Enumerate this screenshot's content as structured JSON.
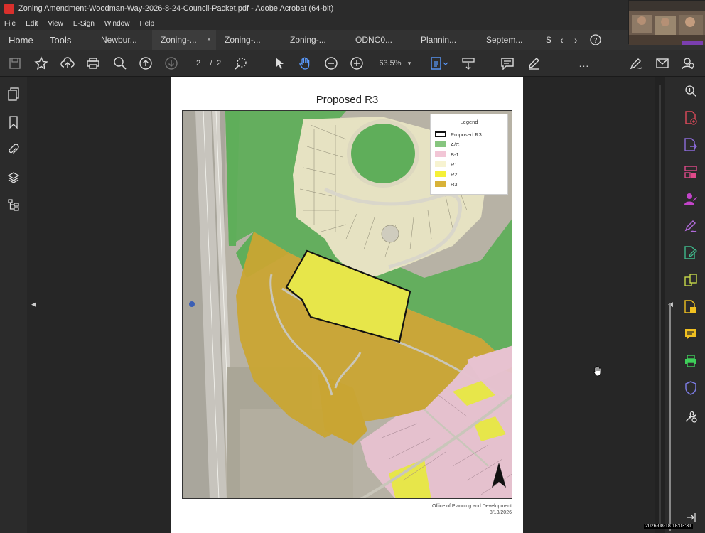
{
  "window": {
    "title": "Zoning Amendment-Woodman-Way-2026-8-24-Council-Packet.pdf - Adobe Acrobat (64-bit)"
  },
  "menu": [
    "File",
    "Edit",
    "View",
    "E-Sign",
    "Window",
    "Help"
  ],
  "tabs": {
    "home": "Home",
    "tools": "Tools",
    "docs": [
      "Newbur...",
      "Zoning-...",
      "Zoning-...",
      "Zoning-...",
      "ODNC0...",
      "Plannin...",
      "Septem..."
    ],
    "overflow": "S"
  },
  "toolbar": {
    "page_current": "2",
    "page_sep": "/",
    "page_total": "2",
    "zoom": "63.5%",
    "more": "..."
  },
  "document": {
    "title": "Proposed R3",
    "footer_line1": "Office of Planning and Development",
    "footer_line2": "8/13/2026"
  },
  "legend": {
    "title": "Legend",
    "items": [
      {
        "label": "Proposed R3",
        "color": "#ffffff"
      },
      {
        "label": "A/C",
        "color": "#86c57f"
      },
      {
        "label": "B-1",
        "color": "#f2c6d6"
      },
      {
        "label": "R1",
        "color": "#f7f3d1"
      },
      {
        "label": "R2",
        "color": "#f5f038"
      },
      {
        "label": "R3",
        "color": "#d8b238"
      }
    ]
  },
  "status": {
    "timestamp": "2026-08-18 18:03:31"
  },
  "colors": {
    "acrobat_red": "#d9302c",
    "accent_blue": "#5a9bff",
    "zone_ac": "#5fae5a",
    "zone_r3": "#c9a533",
    "zone_r2": "#e7e64a",
    "zone_b1": "#e7c2d0",
    "zone_r1": "#e6e2c2"
  }
}
